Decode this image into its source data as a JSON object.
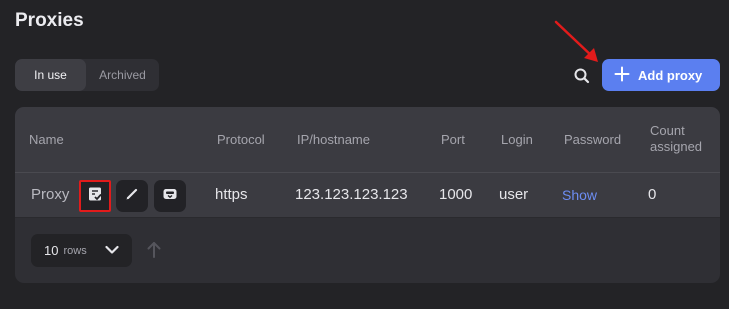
{
  "page": {
    "title": "Proxies"
  },
  "tabs": [
    {
      "label": "In use",
      "active": true
    },
    {
      "label": "Archived",
      "active": false
    }
  ],
  "toolbar": {
    "search_icon": "search-icon",
    "add_label": "Add proxy",
    "add_icon": "plus-icon"
  },
  "table": {
    "columns": [
      "Name",
      "Protocol",
      "IP/hostname",
      "Port",
      "Login",
      "Password",
      "Count assigned"
    ],
    "rows": [
      {
        "name": "Proxy",
        "actions": [
          "check-list-icon",
          "pencil-icon",
          "archive-icon"
        ],
        "protocol": "https",
        "ip": "123.123.123.123",
        "port": "1000",
        "login": "user",
        "password": "Show",
        "count": "0"
      }
    ]
  },
  "pagination": {
    "rows_value": "10",
    "rows_unit": "rows"
  },
  "colors": {
    "accent": "#5b7ff0",
    "highlight": "#e21b1b",
    "link": "#6d8df2"
  }
}
